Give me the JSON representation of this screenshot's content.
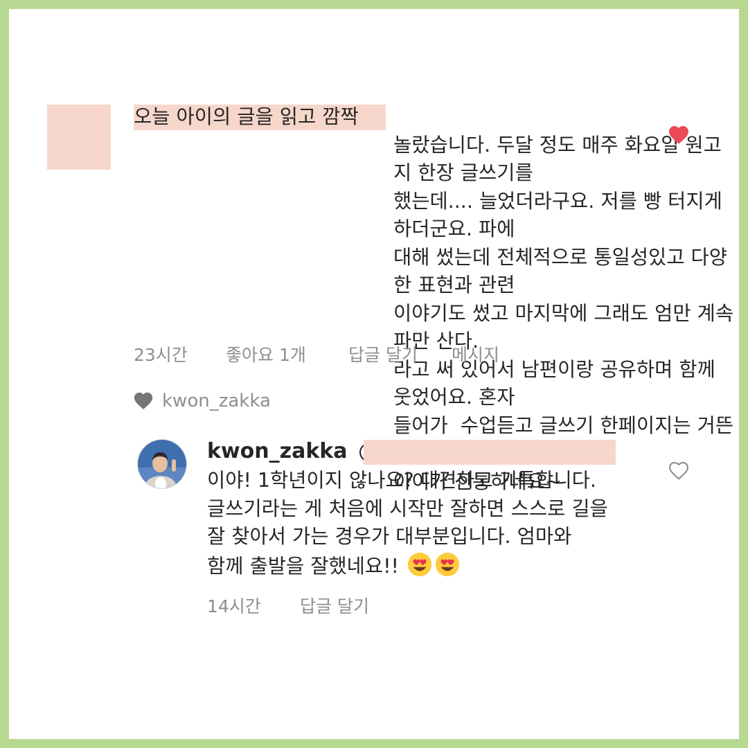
{
  "comment": {
    "text": "오늘 아이의 글을 읽고 깜짝\n놀랐습니다. 두달 정도 매주 화요일 원고지 한장 글쓰기를\n했는데.... 늘었더라구요. 저를 빵 터지게하더군요. 파에\n대해 썼는데 전체적으로 통일성있고 다양한 표현과 관련\n이야기도 썼고 마지막에 그래도 엄만 계속 파만 산다.\n라고 써 있어서 남편이랑 공유하며 함께 웃었어요. 혼자\n들어가  수업듣고 글쓰기 한페이지는 거뜬히 써내는\n아이가 신통하네요~",
    "time": "23시간",
    "likes": "좋아요 1개",
    "reply_label": "답글 달기",
    "message_label": "메시지",
    "liked_by": "kwon_zakka",
    "like_color": "#ed4956"
  },
  "reply": {
    "username": "kwon_zakka",
    "mention_prefix": "@",
    "text_line1": "이야! 1학년이지 않나요? 대견하고 기특합니다.",
    "text_line2": "글쓰기라는 게 처음에 시작만 잘하면 스스로 길을",
    "text_line3": "잘 찾아서 가는 경우가 대부분입니다. 엄마와",
    "text_line4": "함께 출발을 잘했네요!! ",
    "emojis": [
      "heart-eyes-emoji",
      "heart-eyes-emoji"
    ],
    "time": "14시간",
    "reply_label": "답글 달기"
  },
  "colors": {
    "frame": "#b7d891",
    "redaction": "#f7d7cb",
    "text": "#262626",
    "meta": "#8e8e8e"
  }
}
